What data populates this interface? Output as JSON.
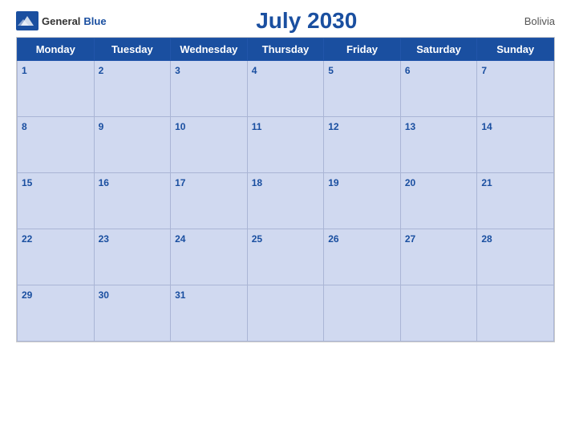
{
  "header": {
    "logo_general": "General",
    "logo_blue": "Blue",
    "title": "July 2030",
    "country": "Bolivia"
  },
  "calendar": {
    "days_of_week": [
      "Monday",
      "Tuesday",
      "Wednesday",
      "Thursday",
      "Friday",
      "Saturday",
      "Sunday"
    ],
    "weeks": [
      [
        {
          "day": 1
        },
        {
          "day": 2
        },
        {
          "day": 3
        },
        {
          "day": 4
        },
        {
          "day": 5
        },
        {
          "day": 6
        },
        {
          "day": 7
        }
      ],
      [
        {
          "day": 8
        },
        {
          "day": 9
        },
        {
          "day": 10
        },
        {
          "day": 11
        },
        {
          "day": 12
        },
        {
          "day": 13
        },
        {
          "day": 14
        }
      ],
      [
        {
          "day": 15
        },
        {
          "day": 16
        },
        {
          "day": 17
        },
        {
          "day": 18
        },
        {
          "day": 19
        },
        {
          "day": 20
        },
        {
          "day": 21
        }
      ],
      [
        {
          "day": 22
        },
        {
          "day": 23
        },
        {
          "day": 24
        },
        {
          "day": 25
        },
        {
          "day": 26
        },
        {
          "day": 27
        },
        {
          "day": 28
        }
      ],
      [
        {
          "day": 29
        },
        {
          "day": 30
        },
        {
          "day": 31
        },
        {
          "day": null
        },
        {
          "day": null
        },
        {
          "day": null
        },
        {
          "day": null
        }
      ]
    ]
  }
}
